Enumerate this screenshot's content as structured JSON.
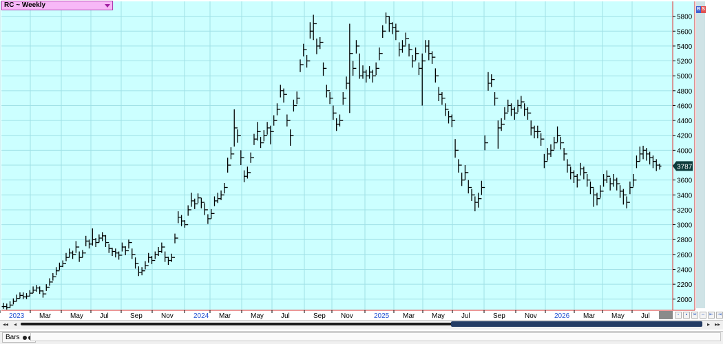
{
  "window": {
    "title": "RC ~ Weekly",
    "badge_b": "B",
    "badge_s": "S",
    "tab_label": "Bars"
  },
  "colors": {
    "plot_bg": "#ccffff",
    "grid": "#9fe0e6",
    "bar": "#000000",
    "axis_line": "#e03030",
    "last_price_bg": "#0d3b3b",
    "last_price_fg": "#ffffff",
    "year_label": "#1f4fd0"
  },
  "chart_data": {
    "type": "ohlc",
    "title": "RC ~ Weekly",
    "ylim": [
      1850,
      6000
    ],
    "y_ticks": [
      2000,
      2200,
      2400,
      2600,
      2800,
      3000,
      3200,
      3400,
      3600,
      3800,
      4000,
      4200,
      4400,
      4600,
      4800,
      5000,
      5200,
      5400,
      5600,
      5800
    ],
    "x_labels": [
      "2023",
      "Mar",
      "May",
      "Jul",
      "Sep",
      "Nov",
      "2024",
      "Mar",
      "May",
      "Jul",
      "Sep",
      "Nov",
      "2025",
      "Mar",
      "May",
      "Jul",
      "Sep",
      "Nov",
      "2026",
      "Mar",
      "May",
      "Jul"
    ],
    "year_labels": [
      "2023",
      "2024",
      "2025",
      "2026"
    ],
    "last_price": 3787,
    "grid": true,
    "closes": [
      1900,
      1890,
      1920,
      1970,
      2010,
      2050,
      2030,
      2040,
      2080,
      2120,
      2150,
      2110,
      2070,
      2160,
      2230,
      2300,
      2380,
      2440,
      2480,
      2560,
      2620,
      2600,
      2700,
      2560,
      2620,
      2780,
      2740,
      2800,
      2760,
      2820,
      2850,
      2760,
      2680,
      2640,
      2620,
      2590,
      2700,
      2650,
      2760,
      2600,
      2480,
      2360,
      2380,
      2450,
      2560,
      2520,
      2600,
      2640,
      2700,
      2560,
      2520,
      2560,
      2820,
      3100,
      3050,
      3000,
      3200,
      3320,
      3280,
      3360,
      3300,
      3200,
      3080,
      3150,
      3320,
      3350,
      3400,
      3500,
      3800,
      3950,
      4300,
      4200,
      3900,
      3650,
      3700,
      3900,
      4150,
      4250,
      4100,
      4200,
      4300,
      4250,
      4400,
      4550,
      4800,
      4750,
      4400,
      4200,
      4600,
      4700,
      5150,
      5350,
      5200,
      5600,
      5700,
      5400,
      5450,
      5100,
      4800,
      4700,
      4500,
      4350,
      4400,
      4700,
      4900,
      5300,
      5100,
      5400,
      5000,
      5050,
      5000,
      5050,
      5000,
      5100,
      5300,
      5600,
      5800,
      5700,
      5650,
      5600,
      5350,
      5400,
      5500,
      5350,
      5200,
      5300,
      5100,
      5200,
      5400,
      5300,
      5250,
      5000,
      4750,
      4700,
      4550,
      4450,
      4400,
      4000,
      3800,
      3600,
      3700,
      3500,
      3400,
      3300,
      3350,
      3500,
      4100,
      4900,
      4950,
      4700,
      4300,
      4350,
      4500,
      4600,
      4550,
      4500,
      4600,
      4650,
      4550,
      4500,
      4300,
      4250,
      4250,
      4150,
      3850,
      3950,
      4000,
      4100,
      4200,
      4100,
      3950,
      3800,
      3700,
      3650,
      3600,
      3750,
      3700,
      3600,
      3500,
      3400,
      3350,
      3450,
      3600,
      3650,
      3550,
      3600,
      3550,
      3450,
      3400,
      3300,
      3500,
      3600,
      3850,
      3950,
      4000,
      3950,
      3900,
      3850,
      3800,
      3787
    ],
    "highs": [
      1950,
      1940,
      1970,
      2010,
      2060,
      2090,
      2090,
      2080,
      2120,
      2170,
      2190,
      2170,
      2120,
      2200,
      2280,
      2350,
      2430,
      2490,
      2520,
      2620,
      2680,
      2650,
      2780,
      2640,
      2660,
      2850,
      2800,
      2950,
      2820,
      2870,
      2900,
      2860,
      2740,
      2690,
      2680,
      2640,
      2760,
      2710,
      2800,
      2680,
      2560,
      2440,
      2430,
      2510,
      2620,
      2580,
      2640,
      2700,
      2760,
      2640,
      2570,
      2610,
      2880,
      3180,
      3130,
      3060,
      3260,
      3430,
      3350,
      3420,
      3360,
      3290,
      3140,
      3210,
      3380,
      3430,
      3460,
      3560,
      3900,
      4040,
      4550,
      4280,
      4000,
      3730,
      3780,
      3970,
      4220,
      4380,
      4180,
      4270,
      4380,
      4330,
      4470,
      4630,
      4880,
      4830,
      4480,
      4280,
      4680,
      4790,
      5220,
      5430,
      5280,
      5720,
      5820,
      5500,
      5520,
      5180,
      4880,
      4780,
      4600,
      4430,
      4480,
      4780,
      4990,
      5700,
      5200,
      5480,
      5300,
      5140,
      5080,
      5130,
      5080,
      5180,
      5380,
      5680,
      5850,
      5800,
      5720,
      5700,
      5450,
      5480,
      5580,
      5430,
      5280,
      5380,
      5180,
      5300,
      5480,
      5480,
      5330,
      5100,
      4850,
      4780,
      4630,
      4530,
      4480,
      4150,
      3880,
      3700,
      3800,
      3600,
      3480,
      3380,
      3430,
      3590,
      4200,
      5050,
      5020,
      4780,
      4400,
      4430,
      4580,
      4680,
      4630,
      4580,
      4680,
      4730,
      4630,
      4580,
      4400,
      4330,
      4330,
      4230,
      3950,
      4030,
      4080,
      4180,
      4320,
      4180,
      4030,
      3880,
      3780,
      3730,
      3680,
      3830,
      3780,
      3680,
      3580,
      3490,
      3430,
      3530,
      3680,
      3730,
      3630,
      3680,
      3630,
      3530,
      3480,
      3380,
      3580,
      3680,
      3930,
      4050,
      4060,
      4030,
      3980,
      3930,
      3880,
      3820
    ],
    "lows": [
      1870,
      1860,
      1880,
      1930,
      1970,
      2010,
      2000,
      2000,
      2040,
      2080,
      2100,
      2070,
      2020,
      2110,
      2180,
      2250,
      2320,
      2390,
      2430,
      2510,
      2560,
      2540,
      2620,
      2500,
      2560,
      2710,
      2680,
      2720,
      2700,
      2760,
      2780,
      2700,
      2620,
      2580,
      2560,
      2530,
      2640,
      2590,
      2680,
      2540,
      2410,
      2310,
      2320,
      2400,
      2490,
      2470,
      2540,
      2580,
      2620,
      2500,
      2460,
      2500,
      2750,
      3020,
      2980,
      2960,
      3120,
      3240,
      3210,
      3290,
      3220,
      3130,
      3010,
      3080,
      3250,
      3290,
      3330,
      3420,
      3700,
      3880,
      4050,
      4100,
      3800,
      3570,
      3620,
      3830,
      4070,
      4130,
      4030,
      4120,
      4210,
      4080,
      4330,
      4470,
      4710,
      4640,
      4320,
      4060,
      4520,
      4620,
      5050,
      5260,
      5110,
      5500,
      5480,
      5290,
      5360,
      5000,
      4710,
      4620,
      4410,
      4260,
      4320,
      4610,
      4820,
      4500,
      5000,
      5300,
      4960,
      4960,
      4910,
      4960,
      4910,
      5010,
      5210,
      5510,
      5700,
      5590,
      5560,
      5480,
      5260,
      5310,
      5410,
      5260,
      5110,
      5210,
      5010,
      4600,
      5310,
      5210,
      5160,
      4910,
      4660,
      4610,
      4460,
      4360,
      4310,
      3900,
      3700,
      3520,
      3600,
      3420,
      3320,
      3180,
      3230,
      3400,
      4000,
      4800,
      4850,
      4600,
      4020,
      4260,
      4410,
      4510,
      4460,
      4410,
      4510,
      4560,
      4460,
      4410,
      4200,
      4160,
      4160,
      4060,
      3760,
      3860,
      3910,
      4010,
      4110,
      4010,
      3860,
      3700,
      3610,
      3560,
      3500,
      3660,
      3610,
      3510,
      3410,
      3240,
      3260,
      3360,
      3510,
      3560,
      3460,
      3510,
      3460,
      3360,
      3270,
      3220,
      3410,
      3510,
      3760,
      3850,
      3880,
      3860,
      3810,
      3760,
      3720,
      3740
    ]
  }
}
